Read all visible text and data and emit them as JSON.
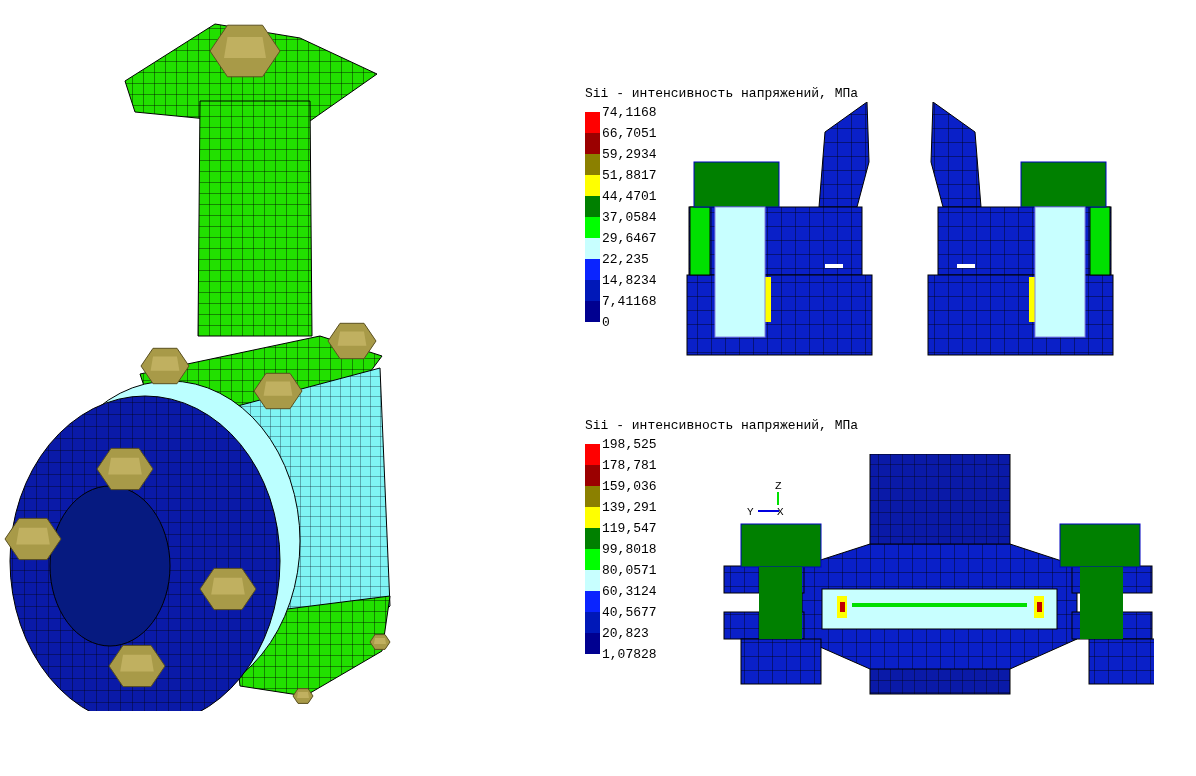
{
  "model_view": {
    "kind": "valve"
  },
  "results": [
    {
      "title": "Sii - интенсивность напряжений, МПа",
      "kind": "section-pair",
      "scale": [
        "74,1168",
        "66,7051",
        "59,2934",
        "51,8817",
        "44,4701",
        "37,0584",
        "29,6467",
        "22,235",
        "14,8234",
        "7,41168",
        "0"
      ],
      "bands": [
        {
          "color": "#ff0000"
        },
        {
          "color": "#9b0000"
        },
        {
          "color": "#8b8000"
        },
        {
          "color": "#ffff00"
        },
        {
          "color": "#008000"
        },
        {
          "color": "#00ff00"
        },
        {
          "color": "#c8ffff"
        },
        {
          "color": "#0a24ff"
        },
        {
          "color": "#0018b8"
        },
        {
          "color": "#000090"
        }
      ]
    },
    {
      "title": "Sii - интенсивность напряжений, МПа",
      "kind": "section-front",
      "axes": {
        "up": "Z",
        "left": "Y",
        "origin": "X"
      },
      "scale": [
        "198,525",
        "178,781",
        "159,036",
        "139,291",
        "119,547",
        "99,8018",
        "80,0571",
        "60,3124",
        "40,5677",
        "20,823",
        "1,07828"
      ],
      "bands": [
        {
          "color": "#ff0000"
        },
        {
          "color": "#9b0000"
        },
        {
          "color": "#8b8000"
        },
        {
          "color": "#ffff00"
        },
        {
          "color": "#008000"
        },
        {
          "color": "#00ff00"
        },
        {
          "color": "#c8ffff"
        },
        {
          "color": "#0a24ff"
        },
        {
          "color": "#0018b8"
        },
        {
          "color": "#000090"
        }
      ]
    }
  ]
}
